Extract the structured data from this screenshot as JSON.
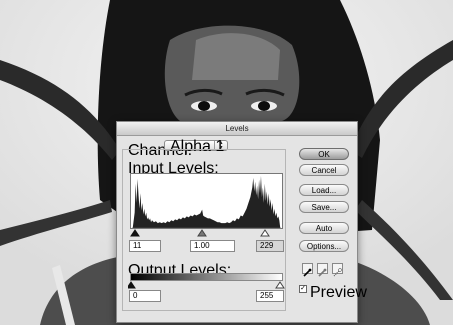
{
  "dialog": {
    "title": "Levels",
    "channel_label": "Channel:",
    "channel_value": "Alpha 1",
    "input_levels_label": "Input Levels:",
    "input_black": "11",
    "input_gamma": "1.00",
    "input_white": "229",
    "output_levels_label": "Output Levels:",
    "output_black": "0",
    "output_white": "255",
    "buttons": {
      "ok": "OK",
      "cancel": "Cancel",
      "load": "Load...",
      "save": "Save...",
      "auto": "Auto",
      "options": "Options..."
    },
    "preview_label": "Preview",
    "preview_checked": true
  },
  "icons": {
    "channel_select": "up-down-arrow-icon",
    "eyedroppers": [
      "black-eyedropper-icon",
      "gray-eyedropper-icon",
      "white-eyedropper-icon"
    ],
    "checkbox": "checkmark-icon"
  }
}
